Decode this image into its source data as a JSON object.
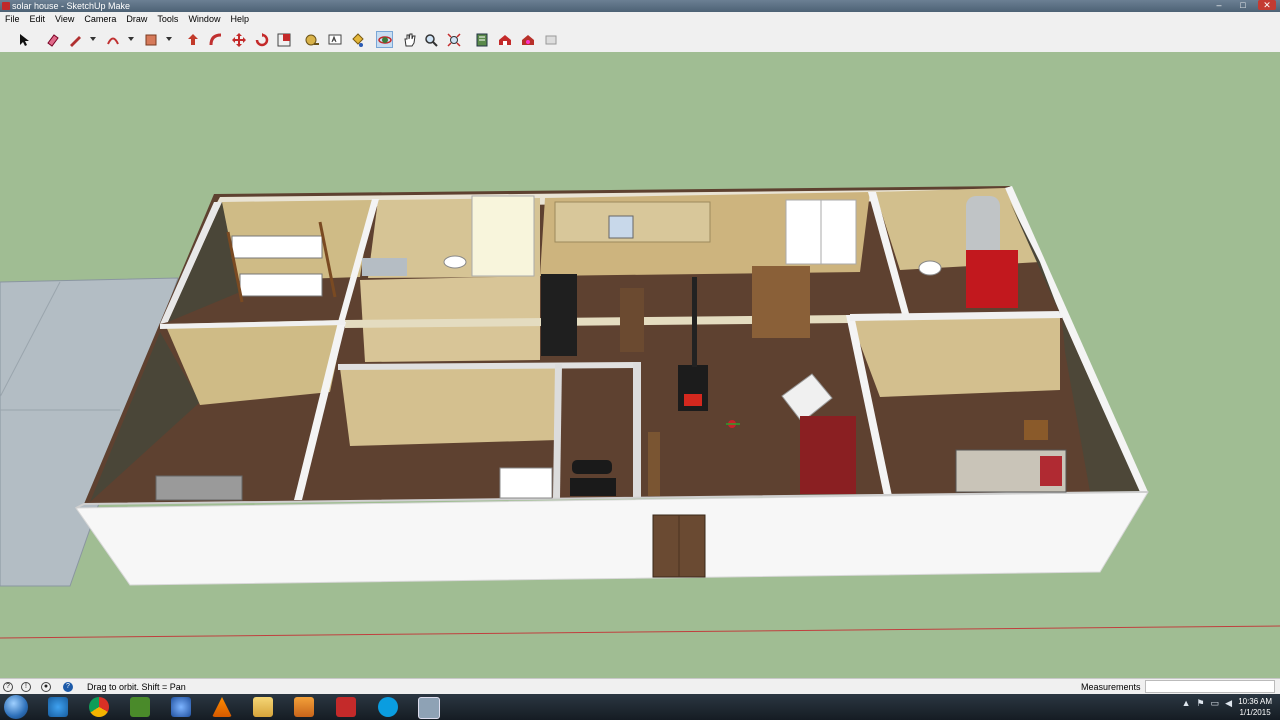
{
  "window": {
    "title": "solar house - SketchUp Make",
    "controls": {
      "minimize": "–",
      "maximize": "□",
      "close": "✕"
    }
  },
  "menu": {
    "items": [
      "File",
      "Edit",
      "View",
      "Camera",
      "Draw",
      "Tools",
      "Window",
      "Help"
    ]
  },
  "toolbar": {
    "tools": [
      "select",
      "eraser",
      "line",
      "arc",
      "rectangle",
      "push-pull",
      "follow-me",
      "move",
      "rotate",
      "scale",
      "tape-measure",
      "text",
      "paint-bucket",
      "orbit",
      "pan",
      "zoom",
      "zoom-extents",
      "get-models",
      "3d-warehouse",
      "extension-warehouse",
      "layout"
    ],
    "active_tool": "orbit"
  },
  "status": {
    "hint": "Drag to orbit.  Shift = Pan",
    "measurements_label": "Measurements",
    "measurements_value": ""
  },
  "taskbar": {
    "apps": [
      "internet-explorer",
      "chrome",
      "minecraft",
      "vlc",
      "file-explorer",
      "media-player",
      "sketchup",
      "skype",
      "window"
    ],
    "clock_time": "10:36 AM",
    "clock_date": "1/1/2015"
  },
  "colors": {
    "sky_ground": "#a0bd93",
    "wall_white": "#f4f4f4",
    "wood_floor": "#5e4130",
    "wood_wall": "#cfbb86",
    "red_marker": "#c8202a"
  }
}
